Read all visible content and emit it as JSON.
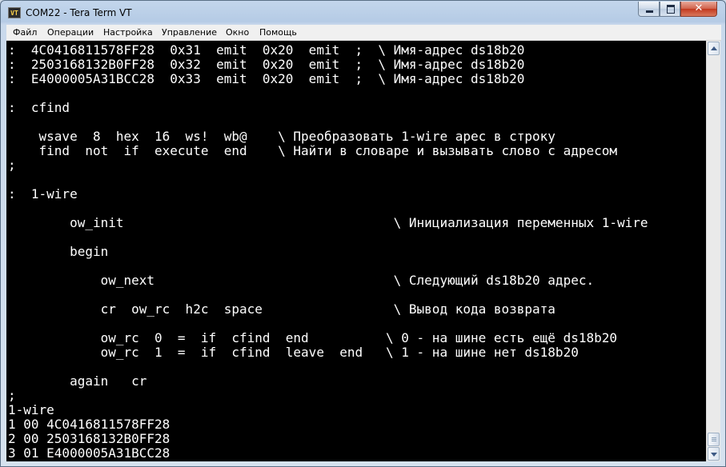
{
  "window": {
    "title": "COM22 - Tera Term VT",
    "icon_label": "VT",
    "close_glyph": "✕"
  },
  "menu": [
    {
      "label": "Файл"
    },
    {
      "label": "Операции"
    },
    {
      "label": "Настройка"
    },
    {
      "label": "Управление"
    },
    {
      "label": "Окно"
    },
    {
      "label": "Помощь"
    }
  ],
  "terminal": {
    "text_color": "#ffffff",
    "background": "#000000",
    "lines": [
      ":  4C0416811578FF28  0x31  emit  0x20  emit  ;  \\ Имя-адрес ds18b20",
      ":  2503168132B0FF28  0x32  emit  0x20  emit  ;  \\ Имя-адрес ds18b20",
      ":  E4000005A31BCC28  0x33  emit  0x20  emit  ;  \\ Имя-адрес ds18b20",
      "",
      ":  cfind",
      "",
      "    wsave  8  hex  16  ws!  wb@    \\ Преобразовать 1-wire арес в строку",
      "    find  not  if  execute  end    \\ Найти в словаре и вызывать слово с адресом",
      ";",
      "",
      ":  1-wire",
      "",
      "        ow_init                                   \\ Инициализация переменных 1-wire",
      "",
      "        begin",
      "",
      "            ow_next                               \\ Следующий ds18b20 адрес.",
      "",
      "            cr  ow_rc  h2c  space                 \\ Вывод кода возврата",
      "",
      "            ow_rc  0  =  if  cfind  end          \\ 0 - на шине есть ещё ds18b20",
      "            ow_rc  1  =  if  cfind  leave  end   \\ 1 - на шине нет ds18b20",
      "",
      "        again   cr",
      ";",
      "1-wire",
      "1 00 4C0416811578FF28",
      "2 00 2503168132B0FF28",
      "3 01 E4000005A31BCC28"
    ]
  }
}
